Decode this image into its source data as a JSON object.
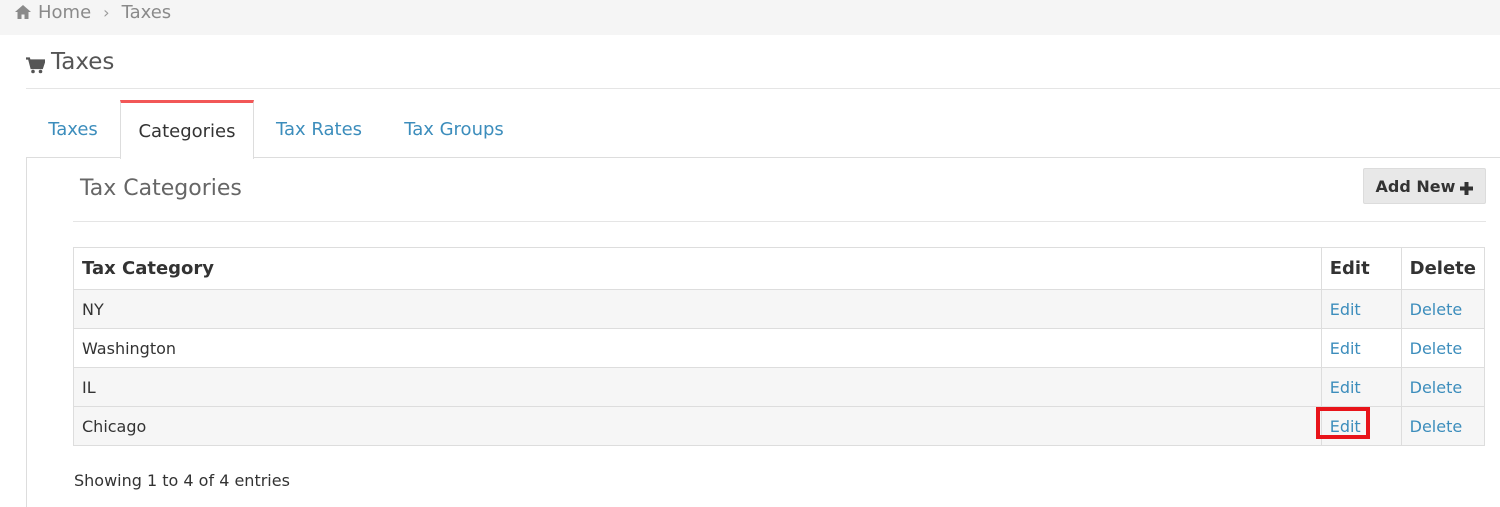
{
  "breadcrumb": {
    "home": "Home",
    "current": "Taxes"
  },
  "page": {
    "title": "Taxes"
  },
  "tabs": [
    {
      "label": "Taxes",
      "active": false
    },
    {
      "label": "Categories",
      "active": true
    },
    {
      "label": "Tax Rates",
      "active": false
    },
    {
      "label": "Tax Groups",
      "active": false
    }
  ],
  "section": {
    "title": "Tax Categories",
    "add_new_label": "Add New"
  },
  "table": {
    "headers": [
      "Tax Category",
      "Edit",
      "Delete"
    ],
    "rows": [
      {
        "category": "NY",
        "edit": "Edit",
        "delete": "Delete"
      },
      {
        "category": "Washington",
        "edit": "Edit",
        "delete": "Delete"
      },
      {
        "category": "IL",
        "edit": "Edit",
        "delete": "Delete"
      },
      {
        "category": "Chicago",
        "edit": "Edit",
        "delete": "Delete"
      }
    ]
  },
  "footer": {
    "info": "Showing 1 to 4 of 4 entries"
  },
  "colors": {
    "link": "#3c8dbc",
    "active_tab_accent": "#f25757",
    "highlight": "#e8141a"
  },
  "icons": {
    "home": "home-icon",
    "title": "cart-icon",
    "add": "plus-icon"
  }
}
